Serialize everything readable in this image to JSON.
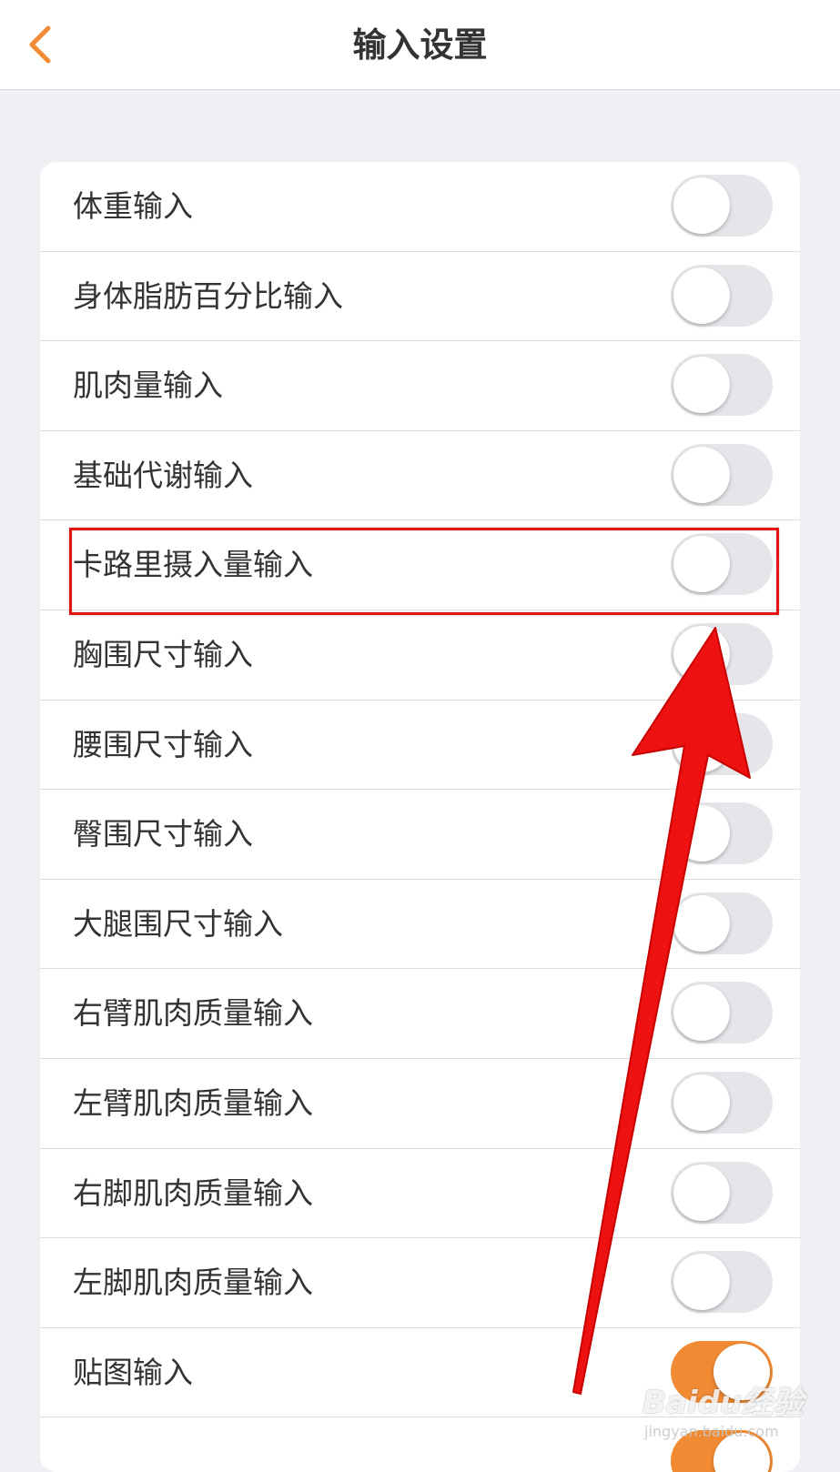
{
  "navbar": {
    "title": "输入设置",
    "back_icon": "chevron-left-icon"
  },
  "colors": {
    "accent": "#f08a33",
    "annotation": "#e31414",
    "background": "#efeff4"
  },
  "settings": [
    {
      "label": "体重输入",
      "on": false
    },
    {
      "label": "身体脂肪百分比输入",
      "on": false
    },
    {
      "label": "肌肉量输入",
      "on": false
    },
    {
      "label": "基础代谢输入",
      "on": false
    },
    {
      "label": "卡路里摄入量输入",
      "on": false
    },
    {
      "label": "胸围尺寸输入",
      "on": false
    },
    {
      "label": "腰围尺寸输入",
      "on": false
    },
    {
      "label": "臀围尺寸输入",
      "on": false
    },
    {
      "label": "大腿围尺寸输入",
      "on": false
    },
    {
      "label": "右臂肌肉质量输入",
      "on": false
    },
    {
      "label": "左臂肌肉质量输入",
      "on": false
    },
    {
      "label": "右脚肌肉质量输入",
      "on": false
    },
    {
      "label": "左脚肌肉质量输入",
      "on": false
    },
    {
      "label": "贴图输入",
      "on": true
    },
    {
      "label": "",
      "on": true
    }
  ],
  "watermark": {
    "main": "Baidu经验",
    "sub": "jingyan.baidu.com"
  }
}
